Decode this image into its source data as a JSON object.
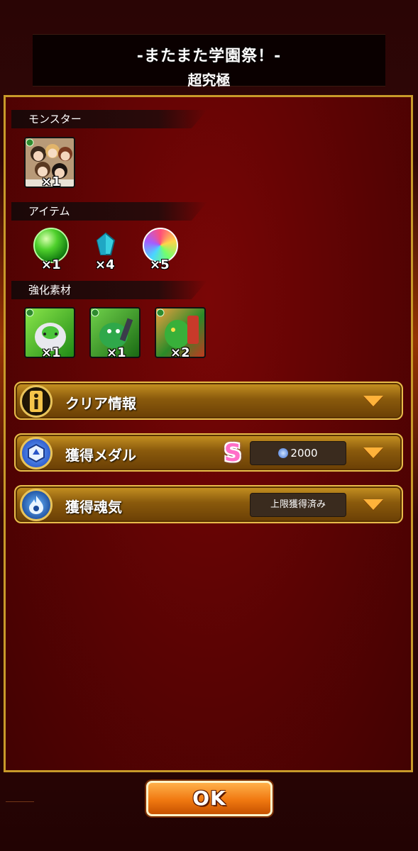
{
  "quest": {
    "title": "-またまた学園祭！-",
    "difficulty": "超究極"
  },
  "sections": {
    "monster": {
      "label": "モンスター",
      "items": [
        {
          "icon": "anime-girls-monster-icon",
          "count": "×1"
        }
      ]
    },
    "items": {
      "label": "アイテム",
      "items": [
        {
          "icon": "green-orb-icon",
          "count": "×1"
        },
        {
          "icon": "blue-crystal-icon",
          "count": "×4"
        },
        {
          "icon": "rainbow-orb-icon",
          "count": "×5"
        }
      ]
    },
    "materials": {
      "label": "強化素材",
      "items": [
        {
          "icon": "green-egg-creature-icon",
          "count": "×1"
        },
        {
          "icon": "green-dragon-icon",
          "count": "×1"
        },
        {
          "icon": "green-warrior-dragon-icon",
          "count": "×2"
        }
      ]
    }
  },
  "bars": {
    "clear_info": {
      "label": "クリア情報",
      "icon": "info-icon"
    },
    "medal": {
      "label": "獲得メダル",
      "icon": "medal-icon",
      "rank": "S",
      "value": "2000"
    },
    "soul": {
      "label": "獲得魂気",
      "icon": "soul-flame-icon",
      "value": "上限獲得済み"
    }
  },
  "ok_label": "OK",
  "colors": {
    "accent_gold": "#c89a2a",
    "panel_red": "#6a0404",
    "button_orange": "#f07810"
  }
}
